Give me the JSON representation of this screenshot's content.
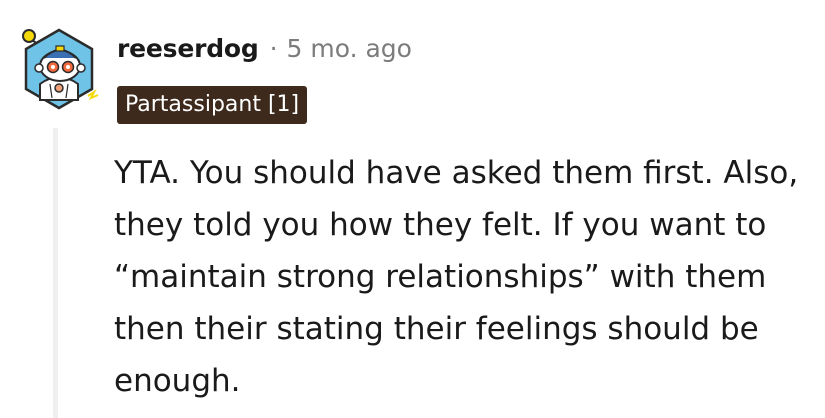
{
  "comment": {
    "author": "reeserdog",
    "separator": "·",
    "timestamp": "5 mo. ago",
    "flair": "Partassipant [1]",
    "body": "YTA. You should have asked them first. Also, they told you how they felt. If you want to “maintain strong relationships” with them then their stating their feelings should be enough."
  },
  "icons": {
    "avatar": "snoo-robot-avatar-icon"
  },
  "colors": {
    "flair_background": "#3d2a1c",
    "flair_text": "#ffffff",
    "muted_text": "#7c7c7c",
    "thread_line": "#edeff1"
  }
}
